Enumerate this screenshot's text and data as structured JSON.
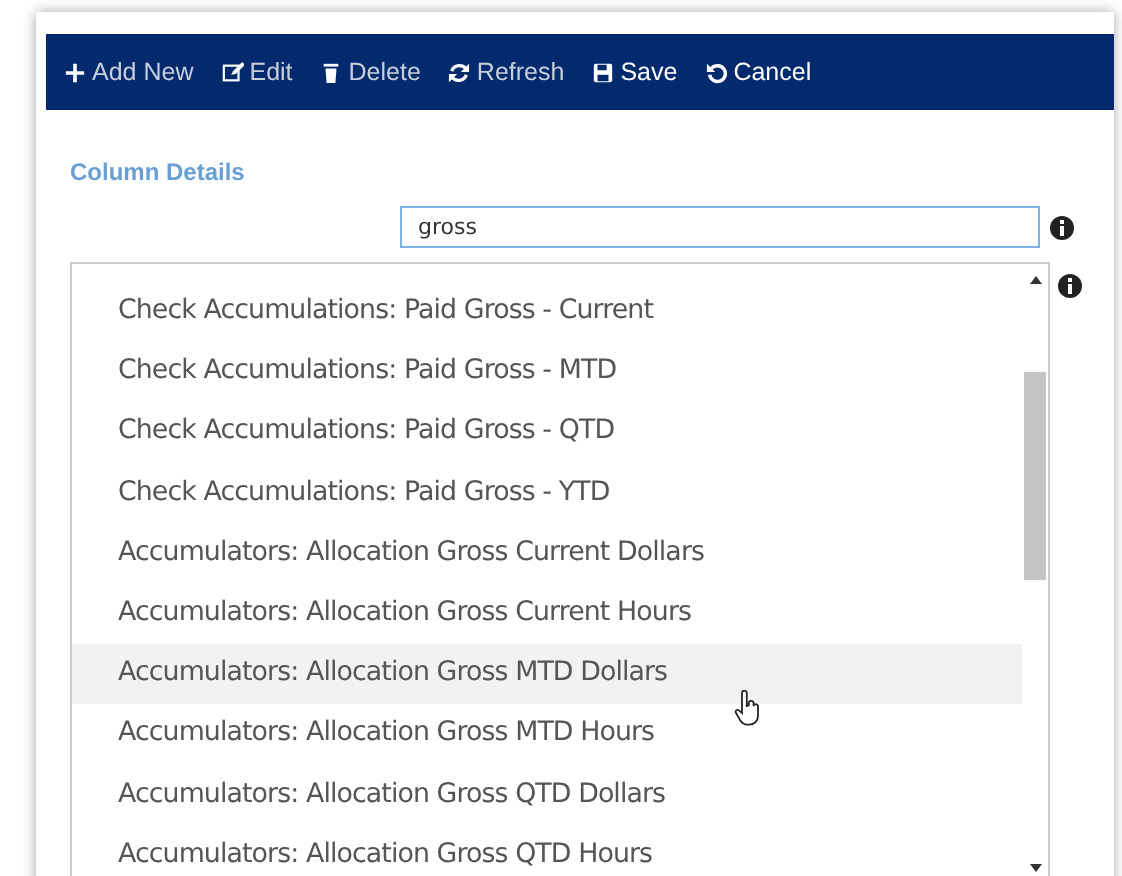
{
  "toolbar": [
    {
      "kind": "add",
      "label": "Add New"
    },
    {
      "kind": "edit",
      "label": "Edit"
    },
    {
      "kind": "delete",
      "label": "Delete"
    },
    {
      "kind": "refresh",
      "label": "Refresh"
    },
    {
      "kind": "save",
      "label": "Save"
    },
    {
      "kind": "cancel",
      "label": "Cancel"
    }
  ],
  "section_title": "Column Details",
  "search": {
    "value": "gross"
  },
  "options": [
    {
      "label": "Check Accumulations: Paid Gross - Current",
      "selected": false
    },
    {
      "label": "Check Accumulations: Paid Gross - MTD",
      "selected": false
    },
    {
      "label": "Check Accumulations: Paid Gross - QTD",
      "selected": false
    },
    {
      "label": "Check Accumulations: Paid Gross - YTD",
      "selected": false
    },
    {
      "label": "Accumulators: Allocation Gross Current Dollars",
      "selected": false
    },
    {
      "label": "Accumulators: Allocation Gross Current Hours",
      "selected": false
    },
    {
      "label": "Accumulators: Allocation Gross MTD Dollars",
      "selected": true
    },
    {
      "label": "Accumulators: Allocation Gross MTD Hours",
      "selected": false
    },
    {
      "label": "Accumulators: Allocation Gross QTD Dollars",
      "selected": false
    },
    {
      "label": "Accumulators: Allocation Gross QTD Hours",
      "selected": false
    }
  ]
}
